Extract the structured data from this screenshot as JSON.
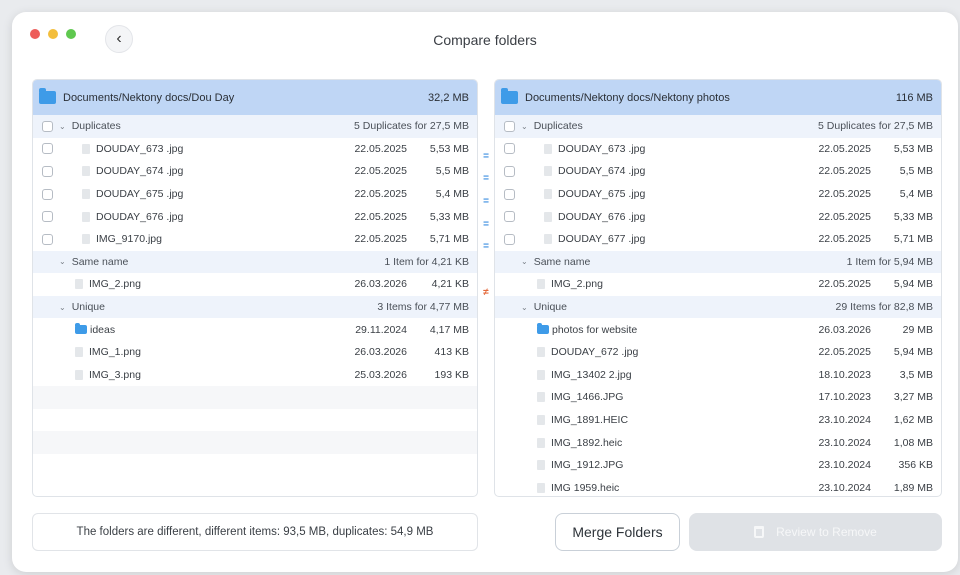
{
  "window": {
    "title": "Compare folders"
  },
  "left": {
    "path": "Documents/Nektony docs/Dou Day",
    "size": "32,2 MB",
    "duplicates": {
      "label": "Duplicates",
      "info": "5 Duplicates for 27,5 MB",
      "items": [
        {
          "name": "DOUDAY_673 .jpg",
          "date": "22.05.2025",
          "size": "5,53 MB"
        },
        {
          "name": "DOUDAY_674 .jpg",
          "date": "22.05.2025",
          "size": "5,5 MB"
        },
        {
          "name": "DOUDAY_675 .jpg",
          "date": "22.05.2025",
          "size": "5,4 MB"
        },
        {
          "name": "DOUDAY_676 .jpg",
          "date": "22.05.2025",
          "size": "5,33 MB"
        },
        {
          "name": "IMG_9170.jpg",
          "date": "22.05.2025",
          "size": "5,71 MB"
        }
      ]
    },
    "same_name": {
      "label": "Same name",
      "info": "1 Item for 4,21 KB",
      "items": [
        {
          "name": "IMG_2.png",
          "date": "26.03.2026",
          "size": "4,21 KB"
        }
      ]
    },
    "unique": {
      "label": "Unique",
      "info": "3 Items for 4,77 MB",
      "items": [
        {
          "name": "ideas",
          "date": "29.11.2024",
          "size": "4,17 MB",
          "type": "folder"
        },
        {
          "name": "IMG_1.png",
          "date": "26.03.2026",
          "size": "413 KB",
          "type": "file"
        },
        {
          "name": "IMG_3.png",
          "date": "25.03.2026",
          "size": "193 KB",
          "type": "file"
        }
      ]
    }
  },
  "right": {
    "path": "Documents/Nektony docs/Nektony photos",
    "size": "116 MB",
    "duplicates": {
      "label": "Duplicates",
      "info": "5 Duplicates for 27,5 MB",
      "items": [
        {
          "name": "DOUDAY_673 .jpg",
          "date": "22.05.2025",
          "size": "5,53 MB"
        },
        {
          "name": "DOUDAY_674 .jpg",
          "date": "22.05.2025",
          "size": "5,5 MB"
        },
        {
          "name": "DOUDAY_675 .jpg",
          "date": "22.05.2025",
          "size": "5,4 MB"
        },
        {
          "name": "DOUDAY_676 .jpg",
          "date": "22.05.2025",
          "size": "5,33 MB"
        },
        {
          "name": "DOUDAY_677 .jpg",
          "date": "22.05.2025",
          "size": "5,71 MB"
        }
      ]
    },
    "same_name": {
      "label": "Same name",
      "info": "1 Item for 5,94 MB",
      "items": [
        {
          "name": "IMG_2.png",
          "date": "22.05.2025",
          "size": "5,94 MB"
        }
      ]
    },
    "unique": {
      "label": "Unique",
      "info": "29 Items for 82,8 MB",
      "items": [
        {
          "name": "photos for website",
          "date": "26.03.2026",
          "size": "29 MB",
          "type": "folder"
        },
        {
          "name": "DOUDAY_672 .jpg",
          "date": "22.05.2025",
          "size": "5,94 MB",
          "type": "file"
        },
        {
          "name": "IMG_13402 2.jpg",
          "date": "18.10.2023",
          "size": "3,5 MB",
          "type": "file"
        },
        {
          "name": "IMG_1466.JPG",
          "date": "17.10.2023",
          "size": "3,27 MB",
          "type": "file"
        },
        {
          "name": "IMG_1891.HEIC",
          "date": "23.10.2024",
          "size": "1,62 MB",
          "type": "file"
        },
        {
          "name": "IMG_1892.heic",
          "date": "23.10.2024",
          "size": "1,08 MB",
          "type": "file"
        },
        {
          "name": "IMG_1912.JPG",
          "date": "23.10.2024",
          "size": "356 KB",
          "type": "file"
        },
        {
          "name": "IMG 1959.heic",
          "date": "23.10.2024",
          "size": "1,89 MB",
          "type": "file"
        }
      ]
    }
  },
  "compare_marks": {
    "equal": "=",
    "not_equal": "≠"
  },
  "footer": {
    "status": "The folders are different, different items: 93,5 MB, duplicates: 54,9 MB",
    "merge_label": "Merge Folders",
    "review_label": "Review to Remove"
  },
  "colors": {
    "header_bg": "#bfd6f5",
    "section_bg": "#eef3fb",
    "equal_mark": "#3d8fe0",
    "not_equal_mark": "#e46a3c",
    "folder_icon": "#3e9be8"
  }
}
